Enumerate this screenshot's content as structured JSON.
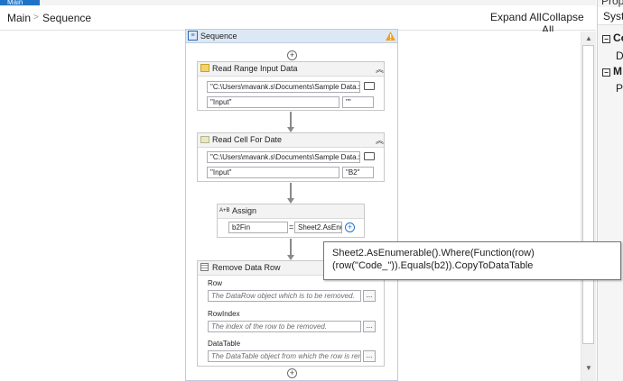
{
  "tabs": {
    "active": "Main"
  },
  "breadcrumb": {
    "root": "Main",
    "separator": ">",
    "current": "Sequence"
  },
  "toolbar": {
    "expand_all": "Expand All",
    "collapse_all": "Collapse All"
  },
  "properties_panel": {
    "title": "Prop",
    "row1": "Syste",
    "group1": "Co",
    "item1": "D",
    "group2": "M",
    "item2": "Pr"
  },
  "sequence": {
    "title": "Sequence",
    "read_range": {
      "title": "Read Range Input Data",
      "path": "\"C:\\Users\\mavank.s\\Documents\\Sample Data.xlsx\"",
      "sheet": "\"Input\"",
      "range": "\"\""
    },
    "read_cell": {
      "title": "Read Cell For Date",
      "path": "\"C:\\Users\\mavank.s\\Documents\\Sample Data.xlsx\"",
      "sheet": "\"Input\"",
      "cell": "\"B2\""
    },
    "assign": {
      "icon_text": "A+B",
      "title": "Assign",
      "to": "b2Fin",
      "equals": "=",
      "value": "Sheet2.AsEnumerable().Where(Function(row) (row(\"Code_\")).Equals(b2)).CopyToDataTable"
    },
    "remove_row": {
      "title": "Remove Data Row",
      "row_label": "Row",
      "row_placeholder": "The DataRow object which is to be removed.",
      "rowindex_label": "RowIndex",
      "rowindex_placeholder": "The index of the row to be removed.",
      "datatable_label": "DataTable",
      "datatable_placeholder": "The DataTable object from which the row is removed.",
      "browse": "..."
    }
  },
  "tooltip": {
    "text": "Sheet2.AsEnumerable().Where(Function(row) (row(\"Code_\")).Equals(b2)).CopyToDataTable"
  },
  "colors": {
    "accent": "#1e73c9",
    "sequence_header": "#dde8f5",
    "warning": "#f0a020"
  }
}
